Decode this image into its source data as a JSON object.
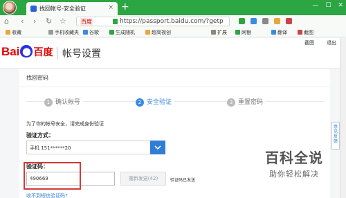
{
  "browser": {
    "tab_title": "找回帐号-安全验证",
    "tab_close": "×",
    "new_tab": "+",
    "win_controls": [
      "—",
      "☐",
      "✕"
    ],
    "site_badge": "百度",
    "url": "https://passport.baidu.com/?getp",
    "bookmarks": [
      "收藏",
      "手机收藏夹",
      "谷歌",
      "生成随机",
      "超简视创"
    ],
    "extensions": [
      "扩展",
      "网银",
      "翻译",
      "截图"
    ]
  },
  "header": {
    "logo_bai": "Bai",
    "logo_paw": "du",
    "logo_du": "",
    "logo_cn": "百度",
    "title": "帐号设置",
    "links": [
      "截图",
      "退出"
    ]
  },
  "card": {
    "title": "找回密码",
    "steps": [
      {
        "num": "1",
        "label": "确认帐号"
      },
      {
        "num": "2",
        "label": "安全验证"
      },
      {
        "num": "3",
        "label": "重置密码"
      }
    ],
    "hint": "为了你的帐号安全，请完成身份验证",
    "method_label": "验证方式：",
    "method_value": "手机 151******20",
    "code_label": "验证码：",
    "code_value": "490669",
    "resend_label": "重新发送(42)",
    "sent_status": "验证码已发送",
    "no_code_link": "收不到短信验证码?"
  },
  "feedback": "意见反馈",
  "watermark": {
    "title": "百科全说",
    "subtitle": "助你轻松解决"
  },
  "colors": {
    "browser_green": "#2ca543",
    "active_step": "#3b8be0",
    "select_button": "#2f7dd8",
    "highlight_frame": "#d23a3a",
    "baidu_red": "#e10601",
    "baidu_blue": "#2932e1"
  }
}
